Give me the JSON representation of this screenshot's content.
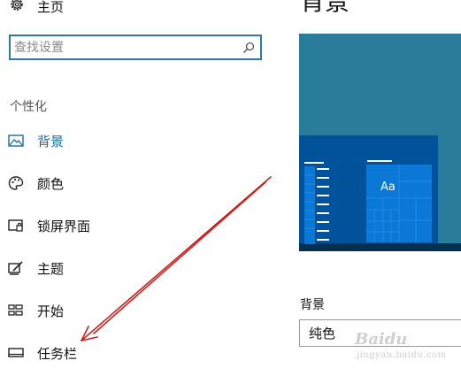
{
  "sidebar": {
    "home_label": "主页",
    "search": {
      "placeholder": "查找设置",
      "value": ""
    },
    "section_header": "个性化",
    "items": [
      {
        "label": "背景",
        "icon": "picture-icon",
        "active": true
      },
      {
        "label": "颜色",
        "icon": "palette-icon",
        "active": false
      },
      {
        "label": "锁屏界面",
        "icon": "lock-screen-icon",
        "active": false
      },
      {
        "label": "主题",
        "icon": "theme-icon",
        "active": false
      },
      {
        "label": "开始",
        "icon": "start-tiles-icon",
        "active": false
      },
      {
        "label": "任务栏",
        "icon": "taskbar-icon",
        "active": false
      }
    ]
  },
  "main": {
    "title": "背景",
    "preview": {
      "tile_text": "Aa"
    },
    "background_label": "背景",
    "background_value": "纯色"
  },
  "watermark": {
    "logo": "Baidu",
    "url": "jingyan.baidu.com"
  },
  "colors": {
    "accent": "#1a6fa5",
    "search_border": "#2a7ab0",
    "preview_bg": "#2a7d9a",
    "window_bg": "#00529b",
    "taskbar": "#05304f",
    "tile": "#0a78d6",
    "annotation_arrow": "#cc1f1f"
  }
}
